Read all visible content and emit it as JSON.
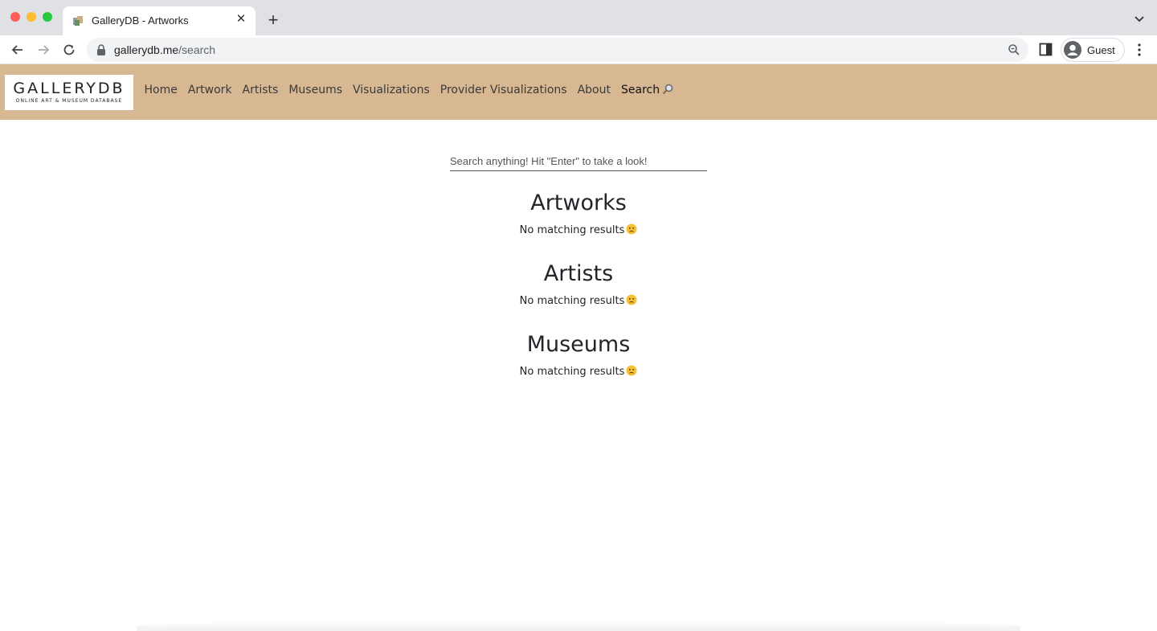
{
  "browser": {
    "tab": {
      "title": "GalleryDB - Artworks"
    },
    "address": {
      "host": "gallerydb.me",
      "path": "/search"
    },
    "profile": {
      "label": "Guest"
    }
  },
  "site": {
    "logo": {
      "main": "GALLERYDB",
      "sub": "ONLINE ART & MUSEUM DATABASE"
    },
    "nav": [
      {
        "label": "Home"
      },
      {
        "label": "Artwork"
      },
      {
        "label": "Artists"
      },
      {
        "label": "Museums"
      },
      {
        "label": "Visualizations"
      },
      {
        "label": "Provider Visualizations"
      },
      {
        "label": "About"
      },
      {
        "label": "Search"
      }
    ]
  },
  "search": {
    "placeholder": "Search anything! Hit \"Enter\" to take a look!",
    "value": ""
  },
  "results": [
    {
      "heading": "Artworks",
      "message": "No matching results"
    },
    {
      "heading": "Artists",
      "message": "No matching results"
    },
    {
      "heading": "Museums",
      "message": "No matching results"
    }
  ],
  "icons": {
    "favicon": "gallery-favicon",
    "back": "arrow-left-icon",
    "forward": "arrow-right-icon",
    "reload": "reload-icon",
    "lock": "lock-icon",
    "zoom": "zoom-icon",
    "side_panel": "side-panel-icon",
    "profile": "avatar-icon",
    "menu": "kebab-menu-icon",
    "search_nav": "magnifier-icon",
    "empty_result": "worried-face-emoji"
  },
  "colors": {
    "navbar": "#d8b892",
    "tabstrip": "#dfe1e5",
    "text": "#212529"
  }
}
